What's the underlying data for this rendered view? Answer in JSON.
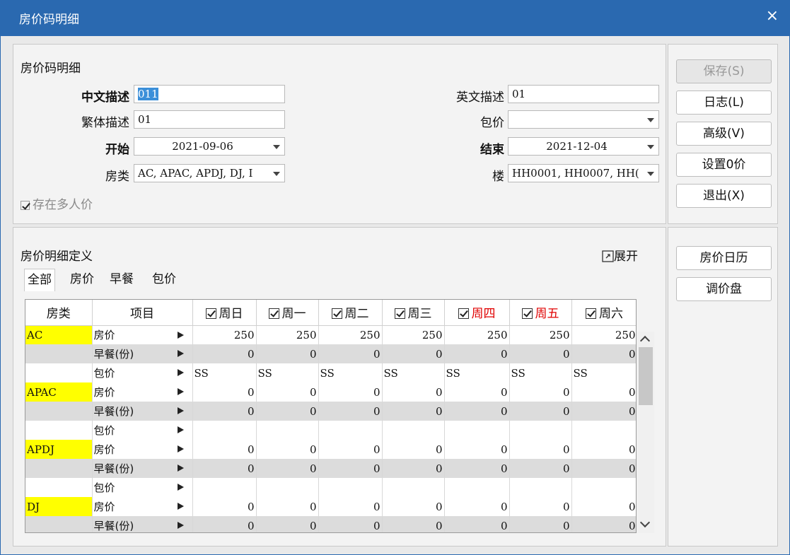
{
  "window": {
    "title": "房价码明细",
    "close": "×"
  },
  "section1": {
    "title": "房价码明细",
    "labels": {
      "cn_desc": "中文描述",
      "en_desc": "英文描述",
      "tw_desc": "繁体描述",
      "package": "包价",
      "start": "开始",
      "end": "结束",
      "room_type": "房类",
      "building": "楼",
      "multi_person": "存在多人价"
    },
    "values": {
      "cn_desc": "011",
      "en_desc": "01",
      "tw_desc": "01",
      "package": "",
      "start": "2021-09-06",
      "end": "2021-12-04",
      "room_type": "AC, APAC, APDJ, DJ, I",
      "building": "HH0001, HH0007, HH("
    }
  },
  "buttons": {
    "save": "保存(S)",
    "log": "日志(L)",
    "advanced": "高级(V)",
    "set_zero": "设置0价",
    "exit": "退出(X)",
    "calendar": "房价日历",
    "adjust": "调价盘"
  },
  "section2": {
    "title": "房价明细定义",
    "expand": "展开",
    "tabs": [
      "全部",
      "房价",
      "早餐",
      "包价"
    ]
  },
  "grid": {
    "headers": {
      "room": "房类",
      "item": "项目"
    },
    "days": [
      {
        "label": "周日",
        "color": "#111111"
      },
      {
        "label": "周一",
        "color": "#111111"
      },
      {
        "label": "周二",
        "color": "#111111"
      },
      {
        "label": "周三",
        "color": "#111111"
      },
      {
        "label": "周四",
        "color": "#e00000"
      },
      {
        "label": "周五",
        "color": "#e00000"
      },
      {
        "label": "周六",
        "color": "#111111"
      }
    ],
    "rows": [
      {
        "room": "AC",
        "item": "房价",
        "values": [
          "250",
          "250",
          "250",
          "250",
          "250",
          "250",
          "250"
        ],
        "gray": false
      },
      {
        "room": "",
        "item": "早餐(份)",
        "values": [
          "0",
          "0",
          "0",
          "0",
          "0",
          "0",
          "0"
        ],
        "gray": true
      },
      {
        "room": "",
        "item": "包价",
        "values": [
          "SS",
          "SS",
          "SS",
          "SS",
          "SS",
          "SS",
          "SS"
        ],
        "gray": false,
        "left": true
      },
      {
        "room": "APAC",
        "item": "房价",
        "values": [
          "0",
          "0",
          "0",
          "0",
          "0",
          "0",
          "0"
        ],
        "gray": false
      },
      {
        "room": "",
        "item": "早餐(份)",
        "values": [
          "0",
          "0",
          "0",
          "0",
          "0",
          "0",
          "0"
        ],
        "gray": true
      },
      {
        "room": "",
        "item": "包价",
        "values": [
          "",
          "",
          "",
          "",
          "",
          "",
          ""
        ],
        "gray": false
      },
      {
        "room": "APDJ",
        "item": "房价",
        "values": [
          "0",
          "0",
          "0",
          "0",
          "0",
          "0",
          "0"
        ],
        "gray": false
      },
      {
        "room": "",
        "item": "早餐(份)",
        "values": [
          "0",
          "0",
          "0",
          "0",
          "0",
          "0",
          "0"
        ],
        "gray": true
      },
      {
        "room": "",
        "item": "包价",
        "values": [
          "",
          "",
          "",
          "",
          "",
          "",
          ""
        ],
        "gray": false
      },
      {
        "room": "DJ",
        "item": "房价",
        "values": [
          "0",
          "0",
          "0",
          "0",
          "0",
          "0",
          "0"
        ],
        "gray": false
      },
      {
        "room": "",
        "item": "早餐(份)",
        "values": [
          "0",
          "0",
          "0",
          "0",
          "0",
          "0",
          "0"
        ],
        "gray": true
      }
    ],
    "highlight_color": "#ffff00"
  }
}
